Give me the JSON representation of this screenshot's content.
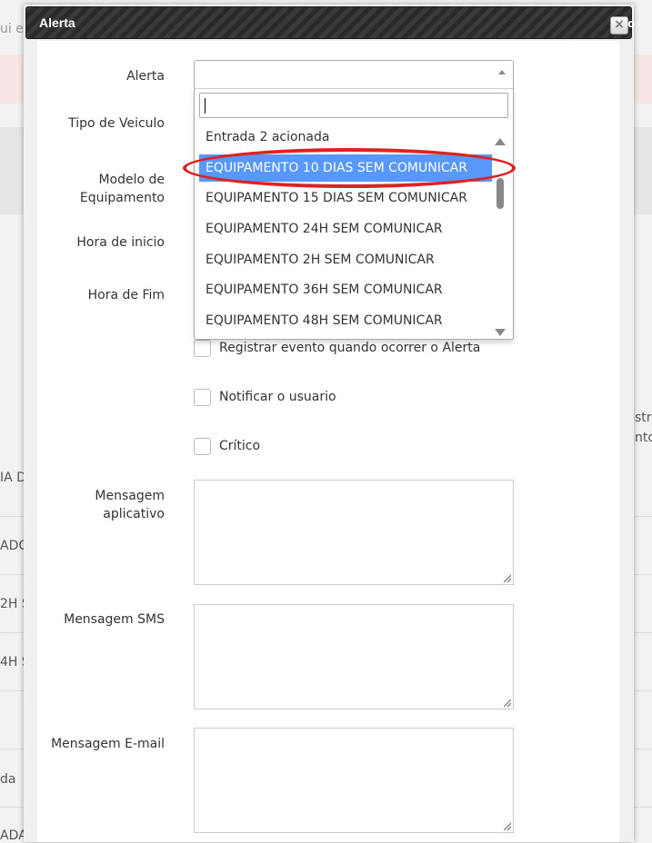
{
  "background": {
    "fragments": [
      "ui e",
      "stra",
      "nto",
      "IA D",
      "ADC",
      "2H S",
      "4H S",
      "da",
      "ADA"
    ]
  },
  "modal": {
    "title": "Alerta",
    "close_glyph": "×",
    "close_extra": "o"
  },
  "form": {
    "labels": {
      "alerta": "Alerta",
      "tipo_veiculo": "Tipo de Veiculo",
      "modelo_line1": "Modelo de",
      "modelo_line2": "Equipamento",
      "hora_inicio": "Hora de inicio",
      "hora_fim": "Hora de Fim",
      "mensagem_app_line1": "Mensagem",
      "mensagem_app_line2": "aplicativo",
      "mensagem_sms": "Mensagem SMS",
      "mensagem_email": "Mensagem E-mail"
    },
    "alerta_select": {
      "value": "",
      "search_value": "",
      "options": [
        "Entrada 2 acionada",
        "EQUIPAMENTO 10 DIAS SEM COMUNICAR",
        "EQUIPAMENTO 15 DIAS SEM COMUNICAR",
        "EQUIPAMENTO 24H SEM COMUNICAR",
        "EQUIPAMENTO 2H SEM COMUNICAR",
        "EQUIPAMENTO 36H SEM COMUNICAR",
        "EQUIPAMENTO 48H SEM COMUNICAR"
      ],
      "highlighted_index": 1
    },
    "checkboxes": {
      "registrar": "Registrar evento quando ocorrer o Alerta",
      "notificar": "Notificar o usuario",
      "critico": "Crítico"
    },
    "textareas": {
      "app": "",
      "sms": "",
      "email": ""
    }
  },
  "colors": {
    "highlight": "#5897fb",
    "annotation": "#dd2222"
  }
}
